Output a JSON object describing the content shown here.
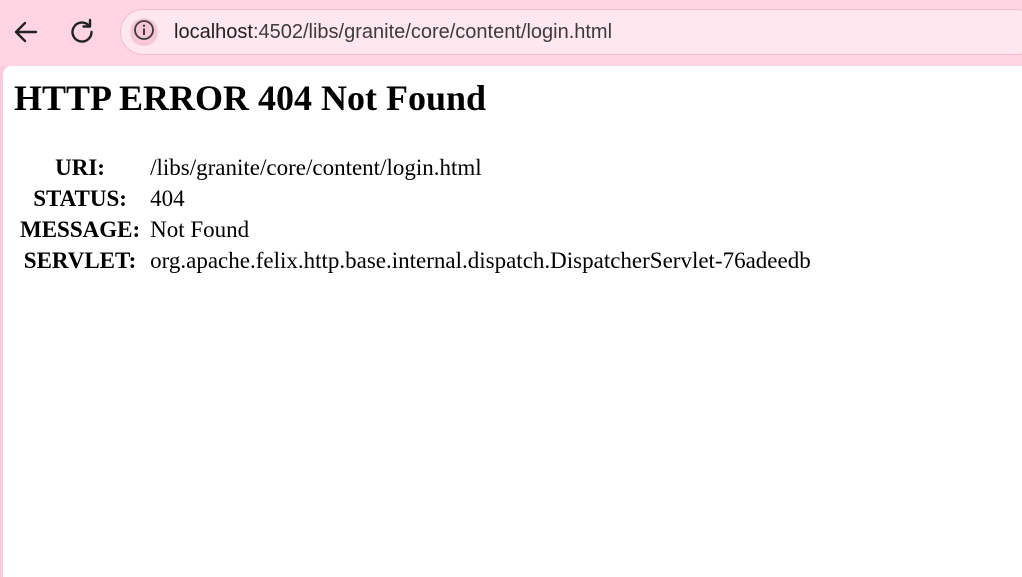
{
  "browser": {
    "url_host": "localhost",
    "url_path": ":4502/libs/granite/core/content/login.html",
    "icons": {
      "back": "arrow-left-icon",
      "reload": "reload-icon",
      "site_info": "info-icon"
    }
  },
  "error_page": {
    "title": "HTTP ERROR 404 Not Found",
    "rows": [
      {
        "label": "URI:",
        "value": "/libs/granite/core/content/login.html"
      },
      {
        "label": "STATUS:",
        "value": "404"
      },
      {
        "label": "MESSAGE:",
        "value": "Not Found"
      },
      {
        "label": "SERVLET:",
        "value": "org.apache.felix.http.base.internal.dispatch.DispatcherServlet-76adeedb"
      }
    ]
  },
  "colors": {
    "chrome_bg": "#ffd4e3",
    "omnibox_bg": "#ffe7ef",
    "page_bg": "#ffffff"
  }
}
